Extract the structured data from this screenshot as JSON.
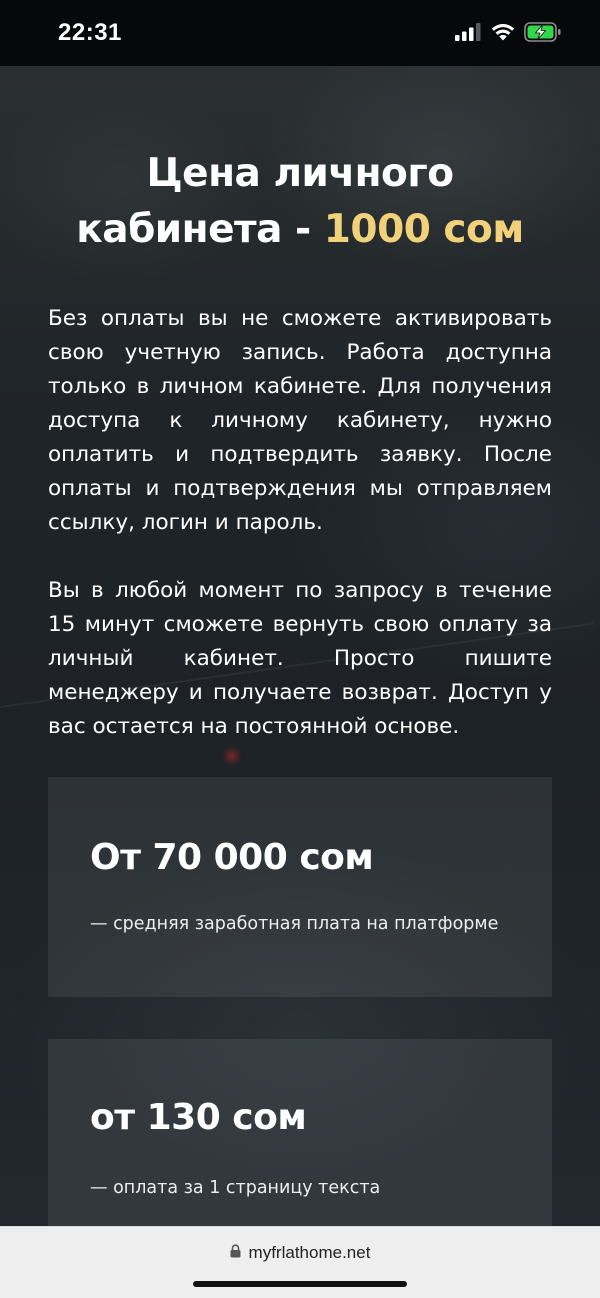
{
  "status_bar": {
    "time": "22:31",
    "signal_icon": "cellular-signal-icon",
    "wifi_icon": "wifi-icon",
    "battery_icon": "battery-charging-icon",
    "battery_color": "#32d74b"
  },
  "hero": {
    "title_line_1": "Цена личного",
    "title_line_2_prefix": "кабинета - ",
    "price": "1000 сом",
    "accent_color": "#f1d27a"
  },
  "paragraphs": [
    "Без оплаты вы не сможете активировать свою учетную запись. Работа доступна только в личном кабинете. Для получения доступа к личному кабинету, нужно оплатить и подтвердить заявку. После оплаты и подтверждения мы отправляем ссылку, логин и пароль.",
    "Вы в любой момент по запросу в течение 15 минут сможете вернуть свою оплату за личный кабинет. Просто пишите менеджеру и получаете возврат. Доступ у вас остается  на постоянной основе."
  ],
  "stats": [
    {
      "value": "От 70 000 сом",
      "description": "—  средняя заработная плата на платформе"
    },
    {
      "value": "от 130 сом",
      "description": "— оплата за 1 страницу текста"
    }
  ],
  "browser": {
    "lock_icon": "lock-icon",
    "url": "myfrlathome.net"
  }
}
